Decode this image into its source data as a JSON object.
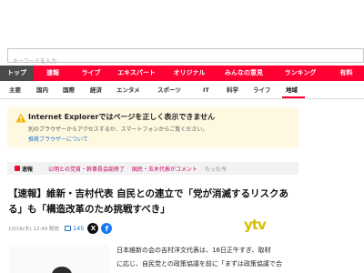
{
  "search": {
    "placeholder": "キーワードを入力"
  },
  "main_nav": {
    "tabs": [
      {
        "label": "トップ",
        "active": true
      },
      {
        "label": "速報"
      },
      {
        "label": "ライブ"
      },
      {
        "label": "エキスパート"
      },
      {
        "label": "オリジナル"
      },
      {
        "label": "みんなの意見"
      },
      {
        "label": "ランキング"
      },
      {
        "label": "有料"
      }
    ]
  },
  "sub_nav": {
    "items": [
      {
        "label": "主要"
      },
      {
        "label": "国内"
      },
      {
        "label": "国際"
      },
      {
        "label": "経済"
      },
      {
        "label": "エンタメ"
      },
      {
        "label": "スポーツ"
      },
      {
        "label": "IT"
      },
      {
        "label": "科学"
      },
      {
        "label": "ライフ"
      },
      {
        "label": "地域",
        "active": true
      }
    ]
  },
  "ie_warning": {
    "title": "Internet Explorerではページを正しく表示できません",
    "body": "別のブラウザーからアクセスするか、スマートフォンからご覧ください。",
    "link": "推奨ブラウザーについて"
  },
  "flash": {
    "label": "速報",
    "items": [
      "公明との党首・幹事長会談終了",
      "国民・玉木代表がコメント"
    ],
    "ago": "たった今"
  },
  "article": {
    "title": "【速報】維新・吉村代表 自民との連立で「党が消滅するリスクある」も「構造改革のため挑戦すべき」",
    "date": "10/16(木) 12:49 配信",
    "comment_count": "145",
    "source_logo": "ytv",
    "body_lines": [
      "日本維新の会の吉村洋文代表は、16日正午すぎ、取材",
      "に応じ、自民党との政策協議を前に「まずは政策協議で合"
    ]
  },
  "colors": {
    "brand": "#ff0033",
    "link": "#1e70c8",
    "logo": "#d8bc00",
    "warning_bg": "#fff8e1"
  }
}
